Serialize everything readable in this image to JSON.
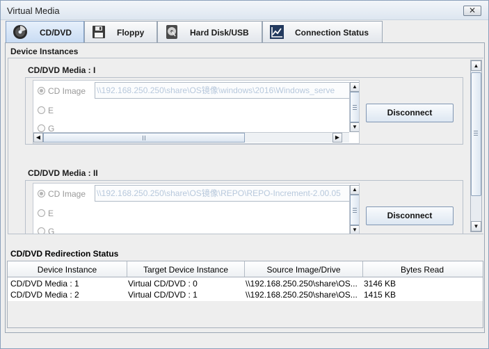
{
  "window": {
    "title": "Virtual Media",
    "close_glyph": "✕"
  },
  "tabs": [
    {
      "label": "CD/DVD",
      "icon": "cd-icon"
    },
    {
      "label": "Floppy",
      "icon": "floppy-icon"
    },
    {
      "label": "Hard Disk/USB",
      "icon": "hard-disk-icon"
    },
    {
      "label": "Connection Status",
      "icon": "chart-icon"
    }
  ],
  "device_instances": {
    "title": "Device Instances",
    "media": [
      {
        "title": "CD/DVD Media : I",
        "options": [
          "CD Image",
          "E",
          "G"
        ],
        "selected": "CD Image",
        "path": "\\\\192.168.250.250\\share\\OS镜像\\windows\\2016\\Windows_serve",
        "button": "Disconnect"
      },
      {
        "title": "CD/DVD Media : II",
        "options": [
          "CD Image",
          "E",
          "G"
        ],
        "selected": "CD Image",
        "path": "\\\\192.168.250.250\\share\\OS镜像\\REPO\\REPO-Increment-2.00.05",
        "button": "Disconnect"
      }
    ]
  },
  "redirection_status": {
    "title": "CD/DVD Redirection Status",
    "columns": [
      "Device Instance",
      "Target Device Instance",
      "Source Image/Drive",
      "Bytes Read"
    ],
    "rows": [
      [
        "CD/DVD Media :  1",
        "Virtual CD/DVD : 0",
        "\\\\192.168.250.250\\share\\OS...",
        "3146 KB"
      ],
      [
        "CD/DVD Media :  2",
        "Virtual CD/DVD : 1",
        "\\\\192.168.250.250\\share\\OS...",
        "1415 KB"
      ]
    ]
  },
  "colors": {
    "accent_tab": "#c7dbf3",
    "field_text": "#b7c8dc"
  }
}
